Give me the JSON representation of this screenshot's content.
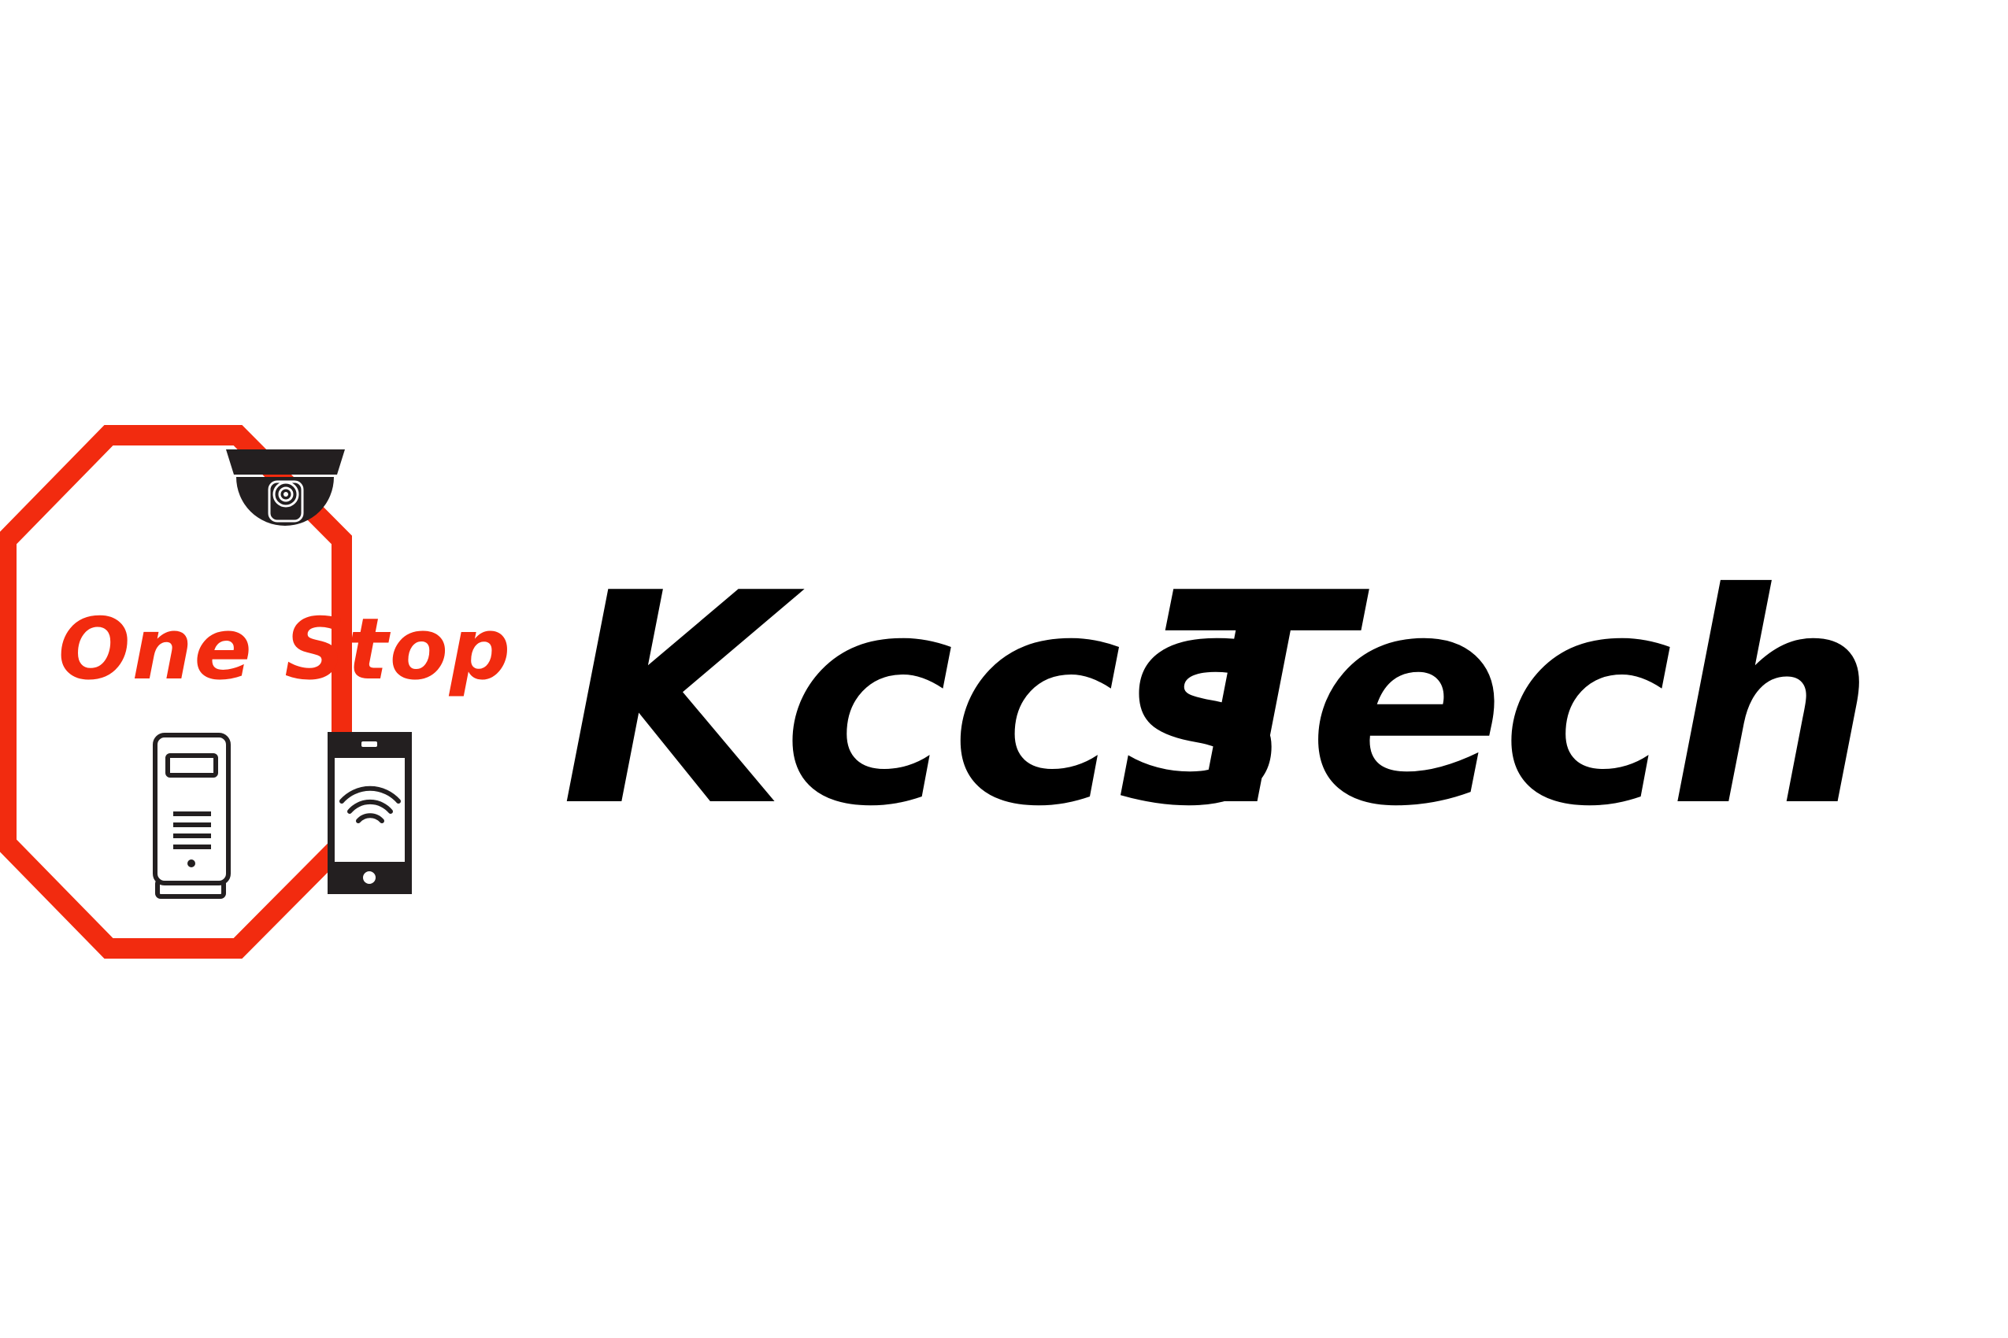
{
  "logo": {
    "badge_text": "One Stop",
    "brand_word_1": "Kccs",
    "brand_word_2": "Tech"
  },
  "colors": {
    "accent": "#f22b0f",
    "ink": "#000000",
    "dark_icon": "#231f20",
    "background": "#ffffff"
  },
  "icons": [
    "security-camera-icon",
    "intercom-panel-icon",
    "smartphone-wifi-icon"
  ]
}
